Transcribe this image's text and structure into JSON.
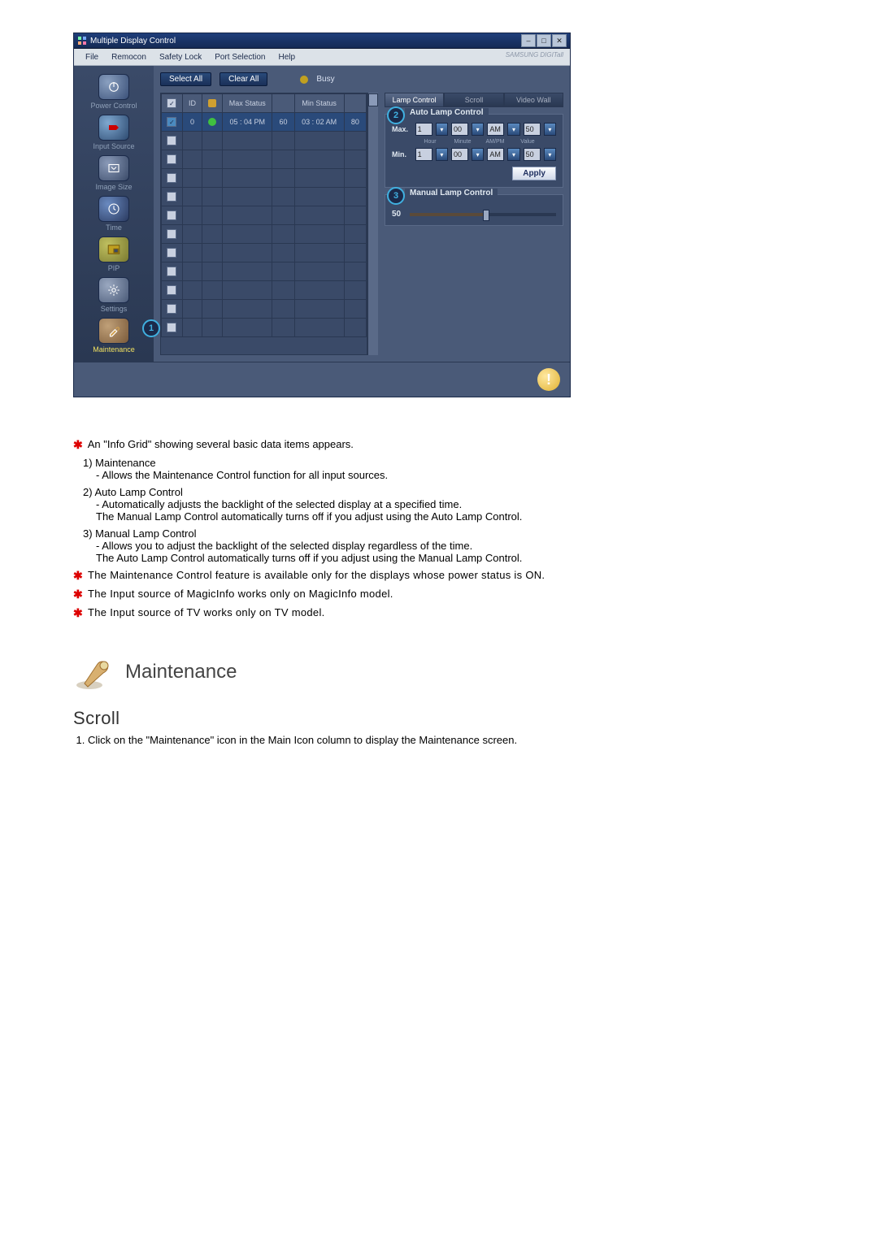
{
  "window": {
    "title": "Multiple Display Control",
    "brand": "SAMSUNG DIGITall",
    "menu": {
      "file": "File",
      "remocon": "Remocon",
      "safety": "Safety Lock",
      "port": "Port Selection",
      "help": "Help"
    },
    "toolbar": {
      "select_all": "Select All",
      "clear_all": "Clear All",
      "busy": "Busy"
    },
    "sidebar": {
      "power": "Power Control",
      "input": "Input Source",
      "image": "Image Size",
      "time": "Time",
      "pip": "PIP",
      "settings": "Settings",
      "maintenance": "Maintenance"
    },
    "grid": {
      "headers": {
        "check": "☑",
        "id": "ID",
        "led": "",
        "max_status": "Max Status",
        "max_val": "",
        "min_status": "Min Status",
        "min_val": ""
      },
      "row0": {
        "id": "0",
        "max_status": "05 : 04 PM",
        "max_val": "60",
        "min_status": "03 : 02 AM",
        "min_val": "80"
      }
    },
    "tabs": {
      "lamp": "Lamp Control",
      "scroll": "Scroll",
      "video": "Video Wall"
    },
    "auto_lamp": {
      "legend": "Auto Lamp Control",
      "max_label": "Max.",
      "min_label": "Min.",
      "col_hour": "Hour",
      "col_minute": "Minute",
      "col_ampm": "AM/PM",
      "col_value": "Value",
      "max_hour": "1",
      "max_minute": "00",
      "max_ampm": "AM",
      "max_value": "50",
      "min_hour": "1",
      "min_minute": "00",
      "min_ampm": "AM",
      "min_value": "50",
      "apply": "Apply"
    },
    "manual_lamp": {
      "legend": "Manual Lamp Control",
      "value": "50"
    },
    "callouts": {
      "c1": "1",
      "c2": "2",
      "c3": "3"
    }
  },
  "doc": {
    "bullet0": "An \"Info Grid\" showing several basic data items appears.",
    "n1_title": "Maintenance",
    "n1_line": "- Allows the Maintenance Control function for all input sources.",
    "n2_title": "Auto Lamp Control",
    "n2_line1": "- Automatically adjusts the backlight of the selected display at a specified time.",
    "n2_line2": "The Manual Lamp Control automatically turns off if you adjust using the Auto Lamp Control.",
    "n3_title": "Manual Lamp Control",
    "n3_line1": "- Allows you to adjust the backlight of the selected display regardless of the time.",
    "n3_line2": "The Auto Lamp Control automatically turns off if you adjust using the Manual Lamp Control.",
    "star1": "The Maintenance Control feature is available only for the displays whose power status is ON.",
    "star2": "The Input source of MagicInfo works only on MagicInfo model.",
    "star3": "The Input source of TV works only on TV model.",
    "section_title": "Maintenance",
    "subtitle": "Scroll",
    "step1": "Click on the \"Maintenance\" icon in the Main Icon column to display the Maintenance screen."
  }
}
